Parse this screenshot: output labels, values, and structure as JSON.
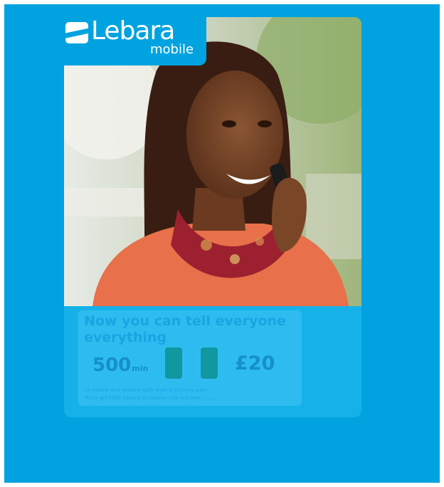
{
  "logo": {
    "wordmark": "Lebara",
    "sub": "mobile"
  },
  "ad": {
    "headline_line1": "Now you can tell everyone",
    "headline_line2": "everything",
    "minutes_value": "500",
    "minutes_unit": "min",
    "price": "£20",
    "line1": "to mobile and landline with Nigeria Country pass",
    "line2": "PLUS get FREE Lebara to Lebara calls and text",
    "line2_note": "terms apply"
  },
  "legal": "",
  "footer": {
    "left": "",
    "right": ""
  },
  "colors": {
    "frame": "#00a3e0",
    "panel": "#2ebcf0",
    "accent": "#0f98a0"
  },
  "icons": {
    "logo_mark": "lebara-flag-icon"
  }
}
